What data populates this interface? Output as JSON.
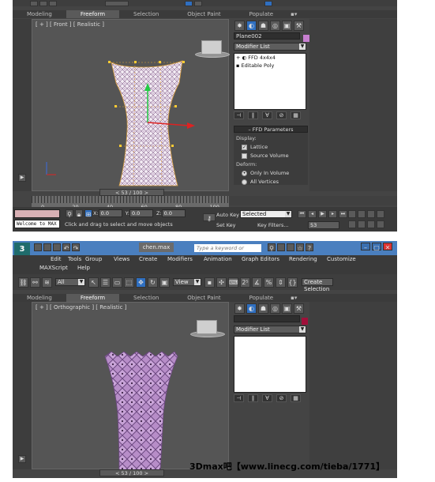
{
  "shot1": {
    "ribbon_tabs": [
      "Modeling",
      "Freeform",
      "Selection",
      "Object Paint",
      "Populate"
    ],
    "active_tab": "Freeform",
    "viewport_label": "[ + ] [ Front ] [ Realistic ]",
    "object_name": "Plane002",
    "swatch_color": "#c77fd0",
    "modifier_list": "Modifier List",
    "stack_items": [
      "FFD 4x4x4",
      "Editable Poly"
    ],
    "rollout_title": "FFD Parameters",
    "display_group": "Display:",
    "lattice_label": "Lattice",
    "lattice_checked": true,
    "source_volume_label": "Source Volume",
    "source_volume_checked": false,
    "deform_group": "Deform:",
    "only_in_volume_label": "Only In Volume",
    "all_vertices_label": "All Vertices",
    "time_slider": "53 / 100",
    "tick_labels": [
      "0",
      "20",
      "40",
      "60",
      "80",
      "100"
    ],
    "welcome": "Welcome to MAX",
    "status_prompt": "Click and drag to select and move objects",
    "x_label": "X:",
    "x_value": "0.0",
    "y_label": "Y:",
    "y_value": "0.0",
    "z_label": "Z:",
    "z_value": "0.0",
    "auto_key": "Auto Key",
    "selected": "Selected",
    "set_key": "Set Key",
    "key_filters": "Key Filters...",
    "frame": "53"
  },
  "shot2": {
    "title_tab": "chen.max",
    "search_placeholder": "Type a keyword or phrase",
    "menu_items": [
      "Edit",
      "Tools",
      "Group",
      "Views",
      "Create",
      "Modifiers",
      "Animation",
      "Graph Editors",
      "Rendering",
      "Customize"
    ],
    "menu_items_row2": [
      "MAXScript",
      "Help"
    ],
    "select_filter": "All",
    "view_dropdown": "View",
    "create_selection": "Create Selection Se",
    "ribbon_tabs": [
      "Modeling",
      "Freeform",
      "Selection",
      "Object Paint",
      "Populate"
    ],
    "active_tab": "Freeform",
    "viewport_label": "[ + ] [ Orthographic ] [ Realistic ]",
    "swatch_color": "#a0103a",
    "modifier_list": "Modifier List",
    "time_slider": "53 / 100"
  },
  "watermark": "3Dmax吧【www.linecg.com/tieba/1771】"
}
